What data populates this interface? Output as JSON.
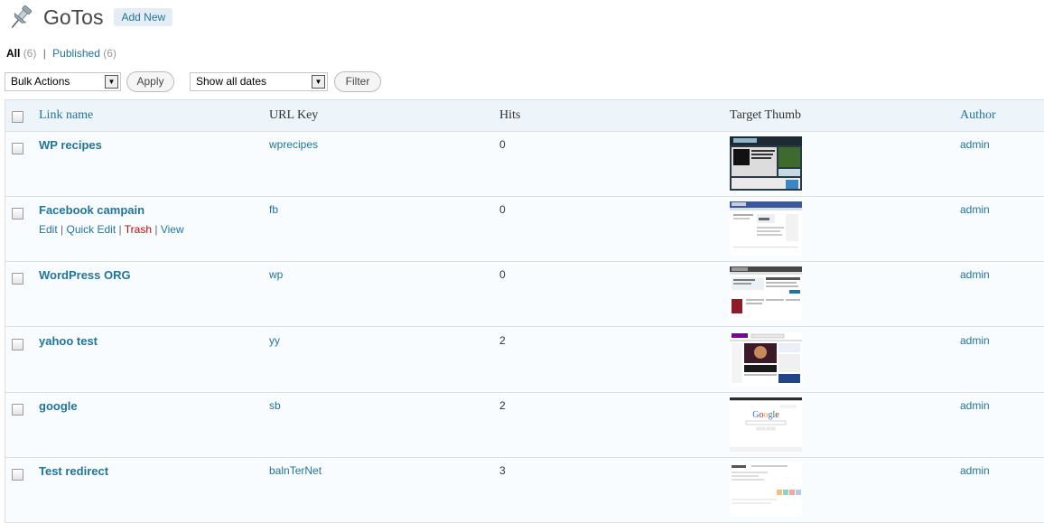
{
  "header": {
    "title": "GoTos",
    "add_new_label": "Add New",
    "icon": "pushpin-icon"
  },
  "filters": {
    "all_label": "All",
    "all_count": "(6)",
    "separator": "|",
    "published_label": "Published",
    "published_count": "(6)"
  },
  "tablenav": {
    "bulk_actions_value": "Bulk Actions",
    "apply_label": "Apply",
    "dates_value": "Show all dates",
    "filter_label": "Filter"
  },
  "columns": {
    "link_name": "Link name",
    "url_key": "URL Key",
    "hits": "Hits",
    "target_thumb": "Target Thumb",
    "author": "Author"
  },
  "rows": [
    {
      "name": "WP recipes",
      "key": "wprecipes",
      "hits": "0",
      "author": "admin",
      "thumb": "wprecipes-thumbnail"
    },
    {
      "name": "Facebook campain",
      "key": "fb",
      "hits": "0",
      "author": "admin",
      "thumb": "facebook-thumbnail",
      "actions": {
        "edit": "Edit",
        "quick_edit": "Quick Edit",
        "trash": "Trash",
        "view": "View",
        "sep": "|"
      }
    },
    {
      "name": "WordPress ORG",
      "key": "wp",
      "hits": "0",
      "author": "admin",
      "thumb": "wordpress-thumbnail"
    },
    {
      "name": "yahoo test",
      "key": "yy",
      "hits": "2",
      "author": "admin",
      "thumb": "yahoo-thumbnail"
    },
    {
      "name": "google",
      "key": "sb",
      "hits": "2",
      "author": "admin",
      "thumb": "google-thumbnail"
    },
    {
      "name": "Test redirect",
      "key": "balnTerNet",
      "hits": "3",
      "author": "admin",
      "thumb": "redirect-thumbnail"
    }
  ],
  "colors": {
    "link": "#21759b",
    "trash": "#bc0b0b",
    "header_bg": "#eef5fa",
    "row_bg": "#f9fcfe"
  }
}
